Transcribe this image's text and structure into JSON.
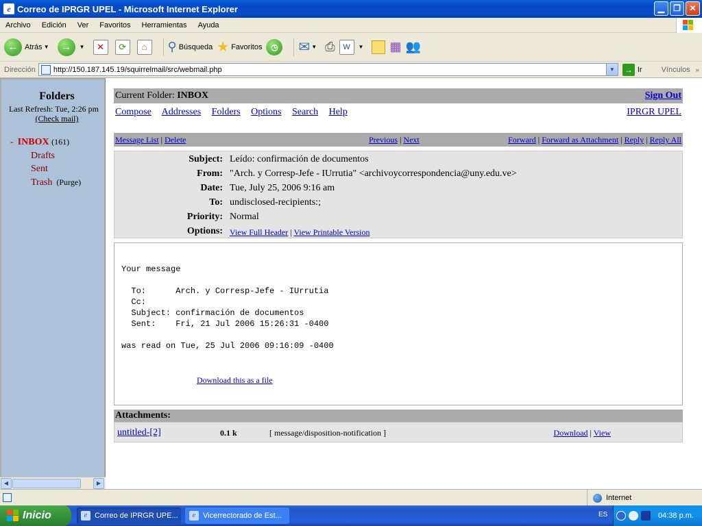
{
  "window": {
    "title": "Correo de IPRGR UPEL - Microsoft Internet Explorer"
  },
  "menu": [
    "Archivo",
    "Edición",
    "Ver",
    "Favoritos",
    "Herramientas",
    "Ayuda"
  ],
  "toolbar": {
    "back": "Atrás",
    "search": "Búsqueda",
    "favorites": "Favoritos"
  },
  "address": {
    "label": "Dirección",
    "url": "http://150.187.145.19/squirrelmail/src/webmail.php",
    "go": "Ir",
    "links": "Vínculos",
    "links_arrow": "»"
  },
  "sidebar": {
    "title": "Folders",
    "last_refresh": "Last Refresh: Tue, 2:26 pm",
    "check_mail": "(Check mail)",
    "inbox": {
      "dash": "-",
      "label": "INBOX",
      "count": "(161)"
    },
    "drafts": "Drafts",
    "sent": "Sent",
    "trash": "Trash",
    "purge": "(Purge)"
  },
  "main": {
    "current_folder_label": "Current Folder:",
    "current_folder": "INBOX",
    "sign_out": "Sign Out",
    "nav": [
      "Compose",
      "Addresses",
      "Folders",
      "Options",
      "Search",
      "Help"
    ],
    "org": "IPRGR UPEL",
    "actions_left": [
      "Message List",
      "Delete"
    ],
    "actions_mid": [
      "Previous",
      "Next"
    ],
    "actions_right": [
      "Forward",
      "Forward as Attachment",
      "Reply",
      "Reply All"
    ]
  },
  "header": {
    "subject_k": "Subject:",
    "subject": "Leído: confirmación de documentos",
    "from_k": "From:",
    "from": "\"Arch. y Corresp-Jefe - IUrrutia\" <archivoycorrespondencia@uny.edu.ve>",
    "date_k": "Date:",
    "date": "Tue, July 25, 2006 9:16 am",
    "to_k": "To:",
    "to": "undisclosed-recipients:;",
    "priority_k": "Priority:",
    "priority": "Normal",
    "options_k": "Options:",
    "opt_full": "View Full Header",
    "opt_print": "View Printable Version"
  },
  "body": {
    "text": "Your message\n\n  To:      Arch. y Corresp-Jefe - IUrrutia\n  Cc:\n  Subject: confirmación de documentos\n  Sent:    Fri, 21 Jul 2006 15:26:31 -0400\n\nwas read on Tue, 25 Jul 2006 09:16:09 -0400",
    "download_file": "Download this as a file"
  },
  "attachments": {
    "title": "Attachments:",
    "name": "untitled-[2]",
    "size": "0.1 k",
    "type": "[ message/disposition-notification ]",
    "download": "Download",
    "view": "View"
  },
  "status": {
    "zone": "Internet"
  },
  "taskbar": {
    "start": "Inicio",
    "task1": "Correo de IPRGR UPE...",
    "task2": "Vicerrectorado de Est...",
    "lang": "ES",
    "clock": "04:38 p.m."
  }
}
